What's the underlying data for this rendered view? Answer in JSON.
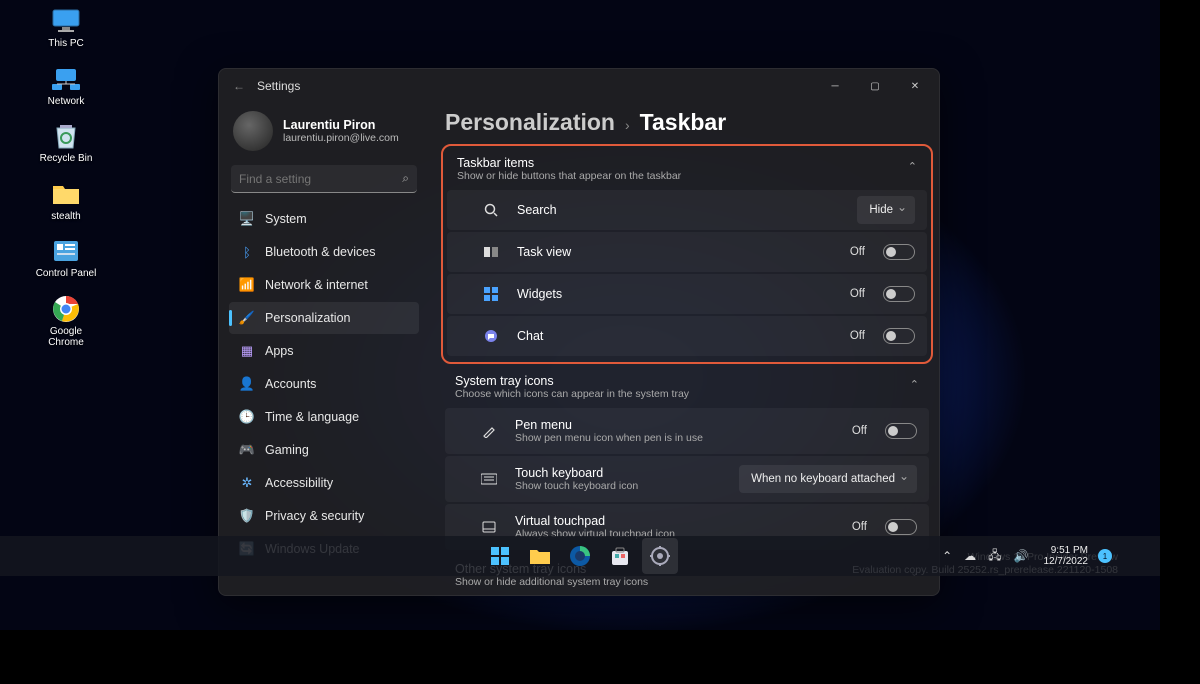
{
  "desktop_icons": [
    {
      "label": "This PC",
      "glyph": "monitor"
    },
    {
      "label": "Network",
      "glyph": "network"
    },
    {
      "label": "Recycle Bin",
      "glyph": "bin"
    },
    {
      "label": "stealth",
      "glyph": "folder"
    },
    {
      "label": "Control Panel",
      "glyph": "control"
    },
    {
      "label": "Google\nChrome",
      "glyph": "chrome"
    }
  ],
  "window": {
    "title": "Settings",
    "account_name": "Laurentiu Piron",
    "account_email": "laurentiu.piron@live.com",
    "search_placeholder": "Find a setting"
  },
  "nav": [
    {
      "label": "System",
      "icon": "🖥️",
      "color": "#4aa3ff"
    },
    {
      "label": "Bluetooth & devices",
      "icon": "ᛒ",
      "color": "#4aa3ff"
    },
    {
      "label": "Network & internet",
      "icon": "📶",
      "color": "#4aa3ff"
    },
    {
      "label": "Personalization",
      "icon": "🖌️",
      "color": "#ff9a56",
      "active": true
    },
    {
      "label": "Apps",
      "icon": "▦",
      "color": "#bda0ff"
    },
    {
      "label": "Accounts",
      "icon": "👤",
      "color": "#57c9a7"
    },
    {
      "label": "Time & language",
      "icon": "🕒",
      "color": "#d09aff"
    },
    {
      "label": "Gaming",
      "icon": "🎮",
      "color": "#7aa8ff"
    },
    {
      "label": "Accessibility",
      "icon": "✲",
      "color": "#6ab8ff"
    },
    {
      "label": "Privacy & security",
      "icon": "🛡️",
      "color": "#9aa4b0"
    },
    {
      "label": "Windows Update",
      "icon": "🔄",
      "color": "#4cc2ff"
    }
  ],
  "breadcrumb": {
    "parent": "Personalization",
    "current": "Taskbar"
  },
  "sections": {
    "taskbar_items": {
      "title": "Taskbar items",
      "sub": "Show or hide buttons that appear on the taskbar",
      "rows": [
        {
          "icon": "search",
          "title": "Search",
          "control": "dropdown",
          "value": "Hide"
        },
        {
          "icon": "taskview",
          "title": "Task view",
          "control": "toggle",
          "state": "Off"
        },
        {
          "icon": "widgets",
          "title": "Widgets",
          "control": "toggle",
          "state": "Off"
        },
        {
          "icon": "chat",
          "title": "Chat",
          "control": "toggle",
          "state": "Off"
        }
      ]
    },
    "system_tray": {
      "title": "System tray icons",
      "sub": "Choose which icons can appear in the system tray",
      "rows": [
        {
          "icon": "pen",
          "title": "Pen menu",
          "sub": "Show pen menu icon when pen is in use",
          "control": "toggle",
          "state": "Off"
        },
        {
          "icon": "keyboard",
          "title": "Touch keyboard",
          "sub": "Show touch keyboard icon",
          "control": "dropdown",
          "value": "When no keyboard attached"
        },
        {
          "icon": "touchpad",
          "title": "Virtual touchpad",
          "sub": "Always show virtual touchpad icon",
          "control": "toggle",
          "state": "Off"
        }
      ]
    },
    "other_tray": {
      "title": "Other system tray icons",
      "sub": "Show or hide additional system tray icons"
    }
  },
  "watermark": {
    "line1": "Windows 11 Pro Insider Preview",
    "line2": "Evaluation copy. Build 25252.rs_prerelease.221120-1508"
  },
  "clock": {
    "time": "9:51 PM",
    "date": "12/7/2022"
  },
  "notif_count": "1"
}
